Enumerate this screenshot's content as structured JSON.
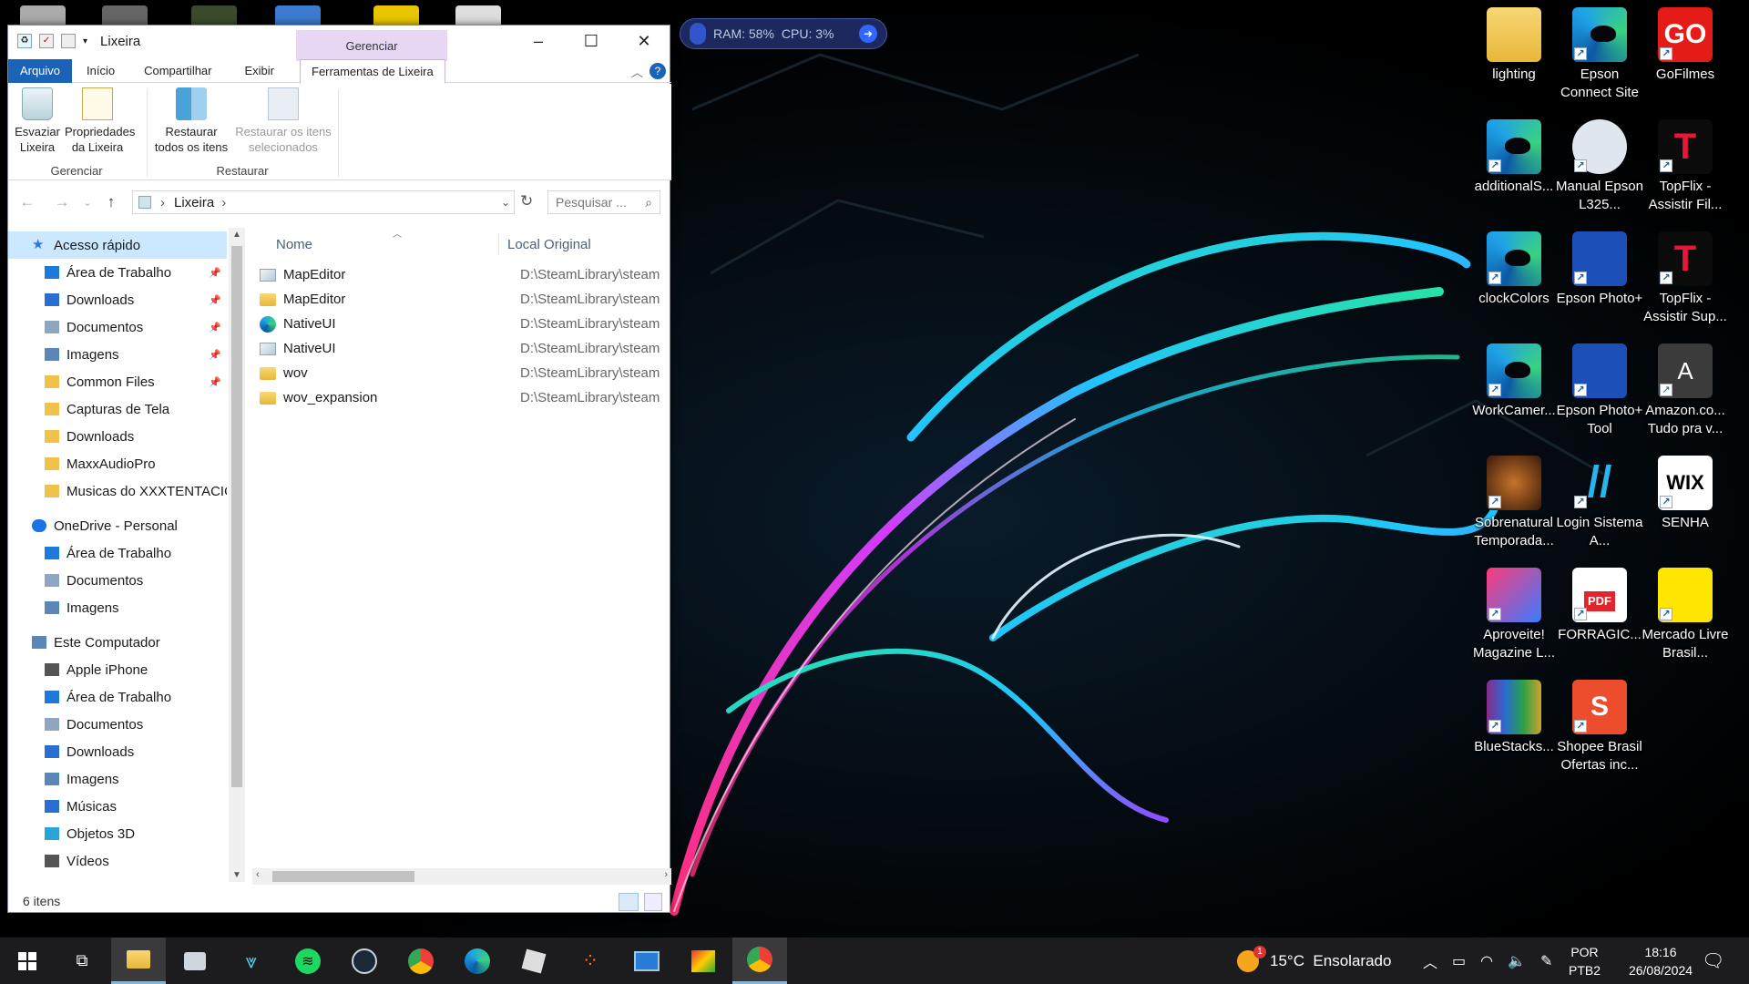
{
  "desktop": {
    "background_colors": [
      "#ff2d78",
      "#21c4ff",
      "#27e2a8",
      "#000000"
    ],
    "icons": [
      {
        "name": "lighting",
        "icon": "folder-icon"
      },
      {
        "name": "Epson Connect Site",
        "icon": "edge-icon"
      },
      {
        "name": "GoFilmes",
        "icon": "gofilmes-icon"
      },
      {
        "name": "additionalS...",
        "icon": "edge-icon"
      },
      {
        "name": "Manual Epson L325...",
        "icon": "manual-icon"
      },
      {
        "name": "TopFlix - Assistir Fil...",
        "icon": "topflix-icon"
      },
      {
        "name": "clockColors",
        "icon": "edge-icon"
      },
      {
        "name": "Epson Photo+",
        "icon": "epson-photo-icon"
      },
      {
        "name": "TopFlix - Assistir Sup...",
        "icon": "topflix-icon"
      },
      {
        "name": "WorkCamer...",
        "icon": "edge-icon"
      },
      {
        "name": "Epson Photo+ Tool",
        "icon": "epson-photo-tool-icon"
      },
      {
        "name": "Amazon.co... Tudo pra v...",
        "icon": "amazon-icon"
      },
      {
        "name": "Sobrenatural Temporada...",
        "icon": "sobrenatural-icon"
      },
      {
        "name": "Login Sistema A...",
        "icon": "login-icon"
      },
      {
        "name": "SENHA",
        "icon": "wix-icon"
      },
      {
        "name": "Aproveite! Magazine L...",
        "icon": "magalu-icon"
      },
      {
        "name": "FORRAGIC...",
        "icon": "pdf-icon"
      },
      {
        "name": "Mercado Livre Brasil...",
        "icon": "mercadolivre-icon"
      },
      {
        "name": "BlueStacks...",
        "icon": "winrar-icon"
      },
      {
        "name": "Shopee Brasil Ofertas inc...",
        "icon": "shopee-icon"
      }
    ],
    "wix_text": "WIX",
    "pdf_text": "PDF",
    "amazon_letter": "A",
    "gofilmes_text": "GO"
  },
  "monitor": {
    "ram": "RAM: 58%",
    "cpu": "CPU: 3%"
  },
  "explorer": {
    "title": "Lixeira",
    "context_tab": "Gerenciar",
    "tabs": [
      "Arquivo",
      "Início",
      "Compartilhar",
      "Exibir",
      "Ferramentas de Lixeira"
    ],
    "ribbon": {
      "empty": "Esvaziar Lixeira",
      "props": "Propriedades da Lixeira",
      "group1": "Gerenciar",
      "restore_all": "Restaurar todos os itens",
      "restore_sel": "Restaurar os itens selecionados",
      "group2": "Restaurar"
    },
    "address": "Lixeira",
    "search_placeholder": "Pesquisar ...",
    "nav": [
      {
        "label": "Acesso rápido",
        "icon": "star-icon",
        "level": 0,
        "selected": true
      },
      {
        "label": "Área de Trabalho",
        "icon": "desktop-icon",
        "level": 1,
        "pinned": true
      },
      {
        "label": "Downloads",
        "icon": "download-icon",
        "level": 1,
        "pinned": true
      },
      {
        "label": "Documentos",
        "icon": "document-icon",
        "level": 1,
        "pinned": true
      },
      {
        "label": "Imagens",
        "icon": "image-icon",
        "level": 1,
        "pinned": true
      },
      {
        "label": "Common Files",
        "icon": "folder-icon",
        "level": 1,
        "pinned": true
      },
      {
        "label": "Capturas de Tela",
        "icon": "folder-icon",
        "level": 1
      },
      {
        "label": "Downloads",
        "icon": "folder-icon",
        "level": 1
      },
      {
        "label": "MaxxAudioPro",
        "icon": "folder-icon",
        "level": 1
      },
      {
        "label": "Musicas do XXXTENTACIO",
        "icon": "folder-icon",
        "level": 1
      },
      {
        "label": "OneDrive - Personal",
        "icon": "cloud-icon",
        "level": 0
      },
      {
        "label": "Área de Trabalho",
        "icon": "desktop-icon",
        "level": 1
      },
      {
        "label": "Documentos",
        "icon": "document-icon",
        "level": 1
      },
      {
        "label": "Imagens",
        "icon": "image-icon",
        "level": 1
      },
      {
        "label": "Este Computador",
        "icon": "computer-icon",
        "level": 0
      },
      {
        "label": "Apple iPhone",
        "icon": "phone-icon",
        "level": 1
      },
      {
        "label": "Área de Trabalho",
        "icon": "desktop-icon",
        "level": 1
      },
      {
        "label": "Documentos",
        "icon": "document-icon",
        "level": 1
      },
      {
        "label": "Downloads",
        "icon": "download-icon",
        "level": 1
      },
      {
        "label": "Imagens",
        "icon": "image-icon",
        "level": 1
      },
      {
        "label": "Músicas",
        "icon": "music-icon",
        "level": 1
      },
      {
        "label": "Objetos 3D",
        "icon": "cube-icon",
        "level": 1
      },
      {
        "label": "Vídeos",
        "icon": "video-icon",
        "level": 1
      }
    ],
    "columns": {
      "name": "Nome",
      "origin": "Local Original"
    },
    "files": [
      {
        "name": "MapEditor",
        "origin": "D:\\SteamLibrary\\steam",
        "icon": "file-icon"
      },
      {
        "name": "MapEditor",
        "origin": "D:\\SteamLibrary\\steam",
        "icon": "folder-icon"
      },
      {
        "name": "NativeUI",
        "origin": "D:\\SteamLibrary\\steam",
        "icon": "edge-icon"
      },
      {
        "name": "NativeUI",
        "origin": "D:\\SteamLibrary\\steam",
        "icon": "file-icon"
      },
      {
        "name": "wov",
        "origin": "D:\\SteamLibrary\\steam",
        "icon": "folder-icon"
      },
      {
        "name": "wov_expansion",
        "origin": "D:\\SteamLibrary\\steam",
        "icon": "folder-icon"
      }
    ],
    "status": "6 itens"
  },
  "taskbar": {
    "weather": "15°C  Ensolarado",
    "weather_badge": "1",
    "lang1": "POR",
    "lang2": "PTB2",
    "time": "18:16",
    "date": "26/08/2024"
  }
}
